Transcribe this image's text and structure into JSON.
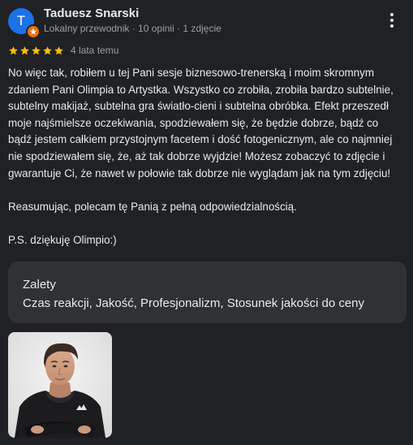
{
  "review": {
    "author": {
      "initial": "T",
      "name": "Taduesz Snarski",
      "meta": "Lokalny przewodnik · 10 opinii · 1 zdjęcie",
      "avatar_color": "#1a73e8",
      "badge_color": "#e8710a"
    },
    "rating": {
      "stars": 5,
      "max": 5,
      "star_color": "#fbbc04",
      "time": "4 lata temu"
    },
    "paragraphs": [
      "No więc tak, robiłem u tej Pani sesje biznesowo-trenerską i moim skromnym zdaniem Pani Olimpia to Artystka. Wszystko co zrobiła, zrobiła bardzo subtelnie, subtelny makijaż, subtelna gra światło-cieni i subtelna obróbka. Efekt przeszedł moje najśmielsze oczekiwania, spodziewałem się, że będzie dobrze, bądź co bądź jestem całkiem przystojnym facetem i dość fotogenicznym, ale co najmniej nie spodziewałem się, że, aż tak dobrze wyjdzie! Możesz zobaczyć to zdjęcie i gwarantuje Ci, że nawet w połowie tak dobrze nie wyglądam jak na tym zdjęciu!",
      "Reasumując, polecam tę Panią z pełną odpowiedzialnością.",
      "P.S. dziękuję Olimpio:)"
    ],
    "pros": {
      "title": "Zalety",
      "values": "Czas reakcji, Jakość, Profesjonalizm, Stosunek jakości do ceny"
    },
    "icons": {
      "more": "more-vert-icon",
      "star": "star-icon",
      "badge": "local-guide-badge-icon"
    }
  }
}
